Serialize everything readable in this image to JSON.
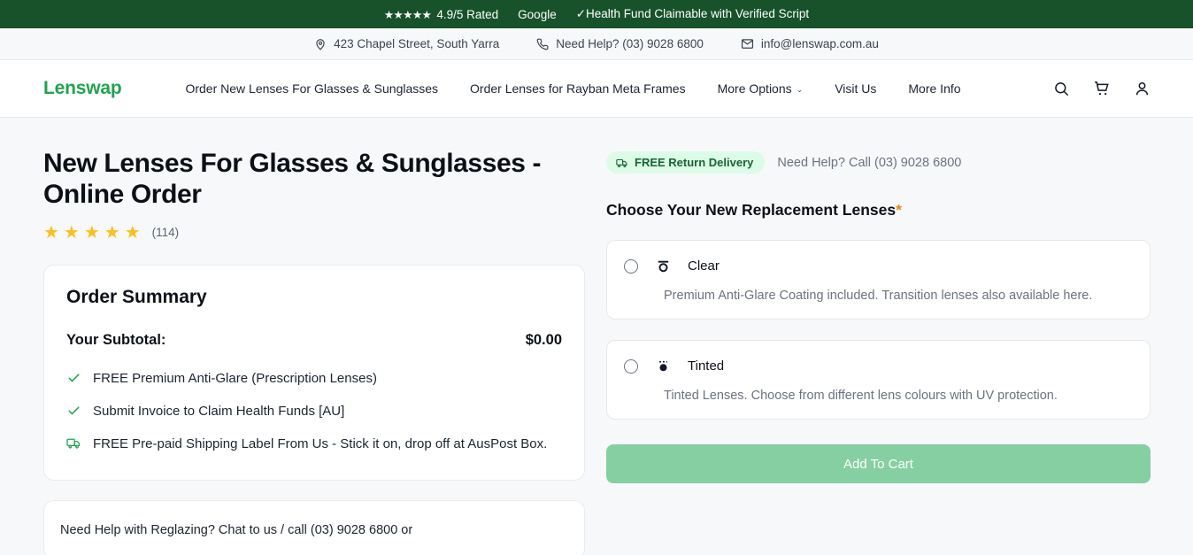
{
  "announcement": {
    "stars": "★★★★★",
    "rating_text": "4.9/5 Rated",
    "source": "Google",
    "claim_text": "✓Health Fund Claimable with Verified Script"
  },
  "contact": {
    "address": "423 Chapel Street, South Yarra",
    "phone": "Need Help? (03) 9028 6800",
    "email": "info@lenswap.com.au"
  },
  "header": {
    "logo": "Lenswap",
    "nav": [
      {
        "label": "Order New Lenses For Glasses & Sunglasses",
        "has_chevron": false
      },
      {
        "label": "Order Lenses for Rayban Meta Frames",
        "has_chevron": false
      },
      {
        "label": "More Options",
        "has_chevron": true
      },
      {
        "label": "Visit Us",
        "has_chevron": false
      },
      {
        "label": "More Info",
        "has_chevron": false
      }
    ],
    "chevron": "⌄"
  },
  "product": {
    "title": "New Lenses For Glasses & Sunglasses - Online Order",
    "stars": "★★★★★",
    "review_count": "(114)"
  },
  "order_summary": {
    "title": "Order Summary",
    "subtotal_label": "Your Subtotal:",
    "subtotal_value": "$0.00",
    "benefits": [
      {
        "icon": "check-icon",
        "text": "FREE Premium Anti-Glare (Prescription Lenses)"
      },
      {
        "icon": "check-icon",
        "text": "Submit Invoice to Claim Health Funds [AU]"
      },
      {
        "icon": "truck-icon",
        "text": "FREE Pre-paid Shipping Label From Us - Stick it on, drop off at AusPost Box."
      }
    ]
  },
  "help_card": {
    "text": "Need Help with Reglazing? Chat to us / call (03) 9028 6800 or"
  },
  "lens_selector": {
    "badge": "FREE Return Delivery",
    "help_inline": "Need Help? Call (03) 9028 6800",
    "heading": "Choose Your New Replacement Lenses",
    "required_mark": "*",
    "options": [
      {
        "label": "Clear",
        "description": "Premium Anti-Glare Coating included. Transition lenses also available here.",
        "icon": "clear-lens-icon",
        "selected": false
      },
      {
        "label": "Tinted",
        "description": "Tinted Lenses. Choose from different lens colours with UV protection.",
        "icon": "tinted-lens-icon",
        "selected": false
      }
    ],
    "add_to_cart_label": "Add To Cart"
  },
  "colors": {
    "announce_bg": "#17522b",
    "brand_green": "#22a34f",
    "badge_bg": "#dcfce7",
    "badge_text": "#166534",
    "star_yellow": "#fbbf24",
    "cta_bg": "#86cfa2",
    "page_bg": "#f7f8fa"
  }
}
